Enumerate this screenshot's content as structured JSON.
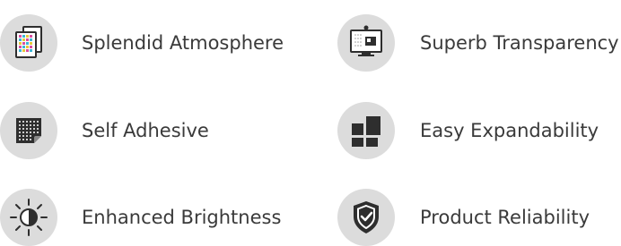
{
  "features": {
    "splendid_atmosphere": {
      "label": "Splendid Atmosphere",
      "icon": "color-panels-icon"
    },
    "self_adhesive": {
      "label": "Self Adhesive",
      "icon": "adhesive-led-film-icon"
    },
    "enhanced_brightness": {
      "label": "Enhanced Brightness",
      "icon": "brightness-icon"
    },
    "superb_transparency": {
      "label": "Superb Transparency",
      "icon": "transparent-display-icon"
    },
    "easy_expandability": {
      "label": "Easy Expandability",
      "icon": "expandable-tiles-icon"
    },
    "product_reliability": {
      "label": "Product Reliability",
      "icon": "shield-check-icon"
    }
  },
  "colors": {
    "icon_background": "#dcdcdc",
    "icon_dark": "#2e2e2e",
    "text": "#3a3a3a",
    "accent_magenta": "#d94fa0",
    "accent_cyan": "#3bb6d6",
    "accent_yellow": "#e6c83a"
  }
}
